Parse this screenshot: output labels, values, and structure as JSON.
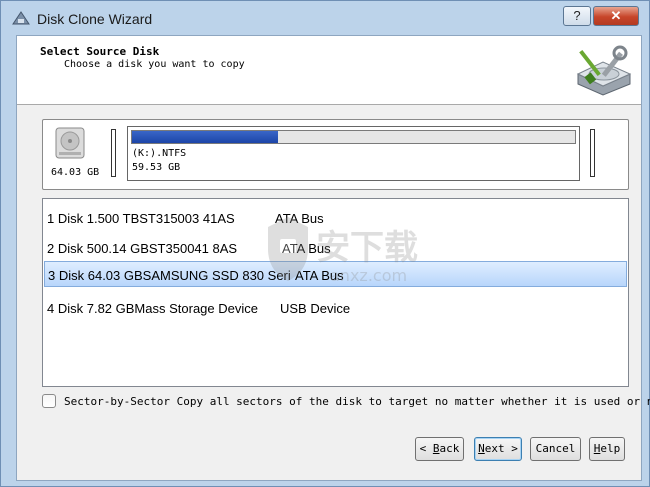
{
  "window": {
    "title": "Disk Clone Wizard",
    "help_glyph": "?",
    "close_glyph": "✕"
  },
  "header": {
    "title": "Select Source Disk",
    "subtitle": "Choose a disk you want to copy"
  },
  "source_disk": {
    "size": "64.03 GB",
    "partition": {
      "label": "(K:).NTFS",
      "size": "59.53 GB",
      "used_fraction": 0.33
    }
  },
  "disk_list": {
    "rows": [
      {
        "name": "1 Disk 1.500 TBST315003 41AS",
        "bus": "ATA Bus",
        "selected": false
      },
      {
        "name": "2 Disk 500.14 GBST350041 8AS",
        "bus": "ATA Bus",
        "selected": false
      },
      {
        "name": "3 Disk 64.03 GBSAMSUNG  SSD 830 Seri",
        "bus": "ATA Bus",
        "selected": true
      },
      {
        "name": "4 Disk 7.82 GBMass    Storage Device",
        "bus": "USB Device",
        "selected": false
      }
    ]
  },
  "watermark": {
    "text": "安下载",
    "sub": "anxz.com"
  },
  "sector_copy": {
    "label": "Sector-by-Sector Copy all sectors of the disk to target no matter whether it is used or not."
  },
  "buttons": {
    "back": {
      "arrow": "<",
      "mnemonic": "B",
      "rest": "ack"
    },
    "next": {
      "mnemonic": "N",
      "rest": "ext",
      "arrow": ">"
    },
    "cancel": "Cancel",
    "help": {
      "mnemonic": "H",
      "rest": "elp"
    }
  },
  "colors": {
    "title_bar": "#bcd3ea",
    "close_button": "#c7452a",
    "partition_fill": "#2a54b8",
    "selection": "#b8d6fb"
  }
}
